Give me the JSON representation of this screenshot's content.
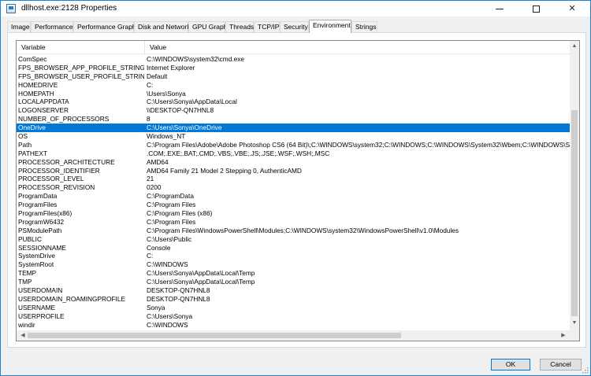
{
  "window": {
    "title": "dllhost.exe:2128 Properties"
  },
  "tabs": [
    {
      "label": "Image"
    },
    {
      "label": "Performance"
    },
    {
      "label": "Performance Graph"
    },
    {
      "label": "Disk and Network"
    },
    {
      "label": "GPU Graph"
    },
    {
      "label": "Threads"
    },
    {
      "label": "TCP/IP"
    },
    {
      "label": "Security"
    },
    {
      "label": "Environment",
      "active": true
    },
    {
      "label": "Strings"
    }
  ],
  "list": {
    "headers": {
      "variable": "Variable",
      "value": "Value"
    },
    "rows": [
      {
        "variable": "ComSpec",
        "value": "C:\\WINDOWS\\system32\\cmd.exe"
      },
      {
        "variable": "FPS_BROWSER_APP_PROFILE_STRING",
        "value": "Internet Explorer"
      },
      {
        "variable": "FPS_BROWSER_USER_PROFILE_STRING",
        "value": "Default"
      },
      {
        "variable": "HOMEDRIVE",
        "value": "C:"
      },
      {
        "variable": "HOMEPATH",
        "value": "\\Users\\Sonya"
      },
      {
        "variable": "LOCALAPPDATA",
        "value": "C:\\Users\\Sonya\\AppData\\Local"
      },
      {
        "variable": "LOGONSERVER",
        "value": "\\\\DESKTOP-QN7HNL8"
      },
      {
        "variable": "NUMBER_OF_PROCESSORS",
        "value": "8"
      },
      {
        "variable": "OneDrive",
        "value": "C:\\Users\\Sonya\\OneDrive",
        "selected": true
      },
      {
        "variable": "OS",
        "value": "Windows_NT"
      },
      {
        "variable": "Path",
        "value": "C:\\Program Files\\Adobe\\Adobe Photoshop CS6 (64 Bit)\\;C:\\WINDOWS\\system32;C:\\WINDOWS;C:\\WINDOWS\\System32\\Wbem;C:\\WINDOWS\\Syste"
      },
      {
        "variable": "PATHEXT",
        "value": ".COM;.EXE;.BAT;.CMD;.VBS;.VBE;.JS;.JSE;.WSF;.WSH;.MSC"
      },
      {
        "variable": "PROCESSOR_ARCHITECTURE",
        "value": "AMD64"
      },
      {
        "variable": "PROCESSOR_IDENTIFIER",
        "value": "AMD64 Family 21 Model 2 Stepping 0, AuthenticAMD"
      },
      {
        "variable": "PROCESSOR_LEVEL",
        "value": "21"
      },
      {
        "variable": "PROCESSOR_REVISION",
        "value": "0200"
      },
      {
        "variable": "ProgramData",
        "value": "C:\\ProgramData"
      },
      {
        "variable": "ProgramFiles",
        "value": "C:\\Program Files"
      },
      {
        "variable": "ProgramFiles(x86)",
        "value": "C:\\Program Files (x86)"
      },
      {
        "variable": "ProgramW6432",
        "value": "C:\\Program Files"
      },
      {
        "variable": "PSModulePath",
        "value": "C:\\Program Files\\WindowsPowerShell\\Modules;C:\\WINDOWS\\system32\\WindowsPowerShell\\v1.0\\Modules"
      },
      {
        "variable": "PUBLIC",
        "value": "C:\\Users\\Public"
      },
      {
        "variable": "SESSIONNAME",
        "value": "Console"
      },
      {
        "variable": "SystemDrive",
        "value": "C:"
      },
      {
        "variable": "SystemRoot",
        "value": "C:\\WINDOWS"
      },
      {
        "variable": "TEMP",
        "value": "C:\\Users\\Sonya\\AppData\\Local\\Temp"
      },
      {
        "variable": "TMP",
        "value": "C:\\Users\\Sonya\\AppData\\Local\\Temp"
      },
      {
        "variable": "USERDOMAIN",
        "value": "DESKTOP-QN7HNL8"
      },
      {
        "variable": "USERDOMAIN_ROAMINGPROFILE",
        "value": "DESKTOP-QN7HNL8"
      },
      {
        "variable": "USERNAME",
        "value": "Sonya"
      },
      {
        "variable": "USERPROFILE",
        "value": "C:\\Users\\Sonya"
      },
      {
        "variable": "windir",
        "value": "C:\\WINDOWS"
      }
    ]
  },
  "buttons": {
    "ok": "OK",
    "cancel": "Cancel"
  },
  "colors": {
    "selection": "#0078d7",
    "window_border": "#1883d7"
  },
  "icons": {
    "app": "window-app-icon",
    "minimize": "minimize-icon",
    "maximize": "maximize-icon",
    "close": "close-icon"
  }
}
